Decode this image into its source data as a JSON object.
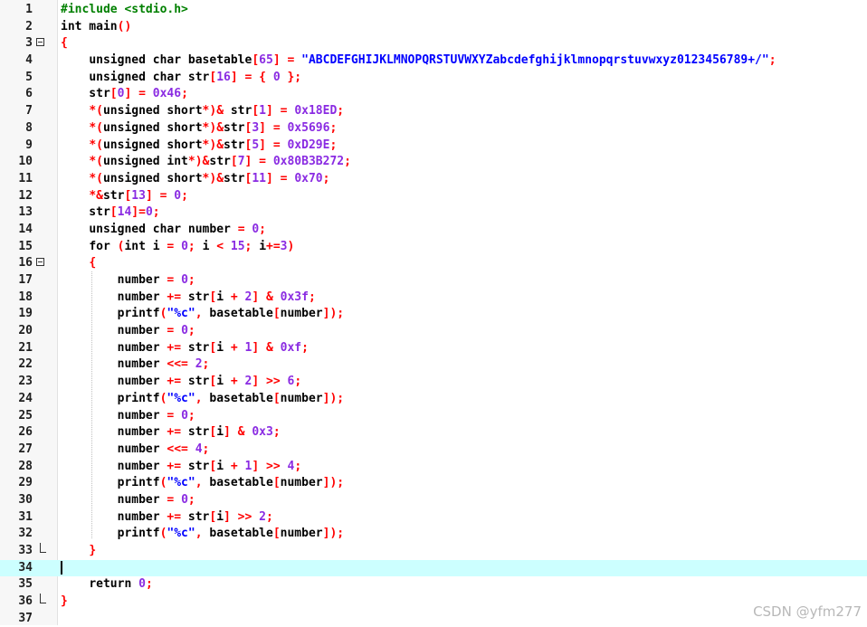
{
  "lines": [
    {
      "n": "1",
      "t": [
        [
          "pp",
          "#include <stdio.h>"
        ]
      ]
    },
    {
      "n": "2",
      "t": [
        [
          "kw",
          "int"
        ],
        [
          "plain",
          " main"
        ],
        [
          "op",
          "()"
        ]
      ]
    },
    {
      "n": "3",
      "fold": "open",
      "t": [
        [
          "op",
          "{"
        ]
      ]
    },
    {
      "n": "4",
      "t": [
        [
          "plain",
          "    "
        ],
        [
          "kw",
          "unsigned char"
        ],
        [
          "plain",
          " basetable"
        ],
        [
          "op",
          "["
        ],
        [
          "num",
          "65"
        ],
        [
          "op",
          "] = "
        ],
        [
          "str",
          "\"ABCDEFGHIJKLMNOPQRSTUVWXYZabcdefghijklmnopqrstuvwxyz0123456789+/\""
        ],
        [
          "op",
          ";"
        ]
      ]
    },
    {
      "n": "5",
      "t": [
        [
          "plain",
          "    "
        ],
        [
          "kw",
          "unsigned char"
        ],
        [
          "plain",
          " str"
        ],
        [
          "op",
          "["
        ],
        [
          "num",
          "16"
        ],
        [
          "op",
          "] = { "
        ],
        [
          "num",
          "0"
        ],
        [
          "op",
          " };"
        ]
      ]
    },
    {
      "n": "6",
      "t": [
        [
          "plain",
          "    str"
        ],
        [
          "op",
          "["
        ],
        [
          "num",
          "0"
        ],
        [
          "op",
          "] = "
        ],
        [
          "num",
          "0x46"
        ],
        [
          "op",
          ";"
        ]
      ]
    },
    {
      "n": "7",
      "t": [
        [
          "plain",
          "    "
        ],
        [
          "op",
          "*("
        ],
        [
          "kw",
          "unsigned short"
        ],
        [
          "op",
          "*)& "
        ],
        [
          "plain",
          "str"
        ],
        [
          "op",
          "["
        ],
        [
          "num",
          "1"
        ],
        [
          "op",
          "] = "
        ],
        [
          "num",
          "0x18ED"
        ],
        [
          "op",
          ";"
        ]
      ]
    },
    {
      "n": "8",
      "t": [
        [
          "plain",
          "    "
        ],
        [
          "op",
          "*("
        ],
        [
          "kw",
          "unsigned short"
        ],
        [
          "op",
          "*)&"
        ],
        [
          "plain",
          "str"
        ],
        [
          "op",
          "["
        ],
        [
          "num",
          "3"
        ],
        [
          "op",
          "] = "
        ],
        [
          "num",
          "0x5696"
        ],
        [
          "op",
          ";"
        ]
      ]
    },
    {
      "n": "9",
      "t": [
        [
          "plain",
          "    "
        ],
        [
          "op",
          "*("
        ],
        [
          "kw",
          "unsigned short"
        ],
        [
          "op",
          "*)&"
        ],
        [
          "plain",
          "str"
        ],
        [
          "op",
          "["
        ],
        [
          "num",
          "5"
        ],
        [
          "op",
          "] = "
        ],
        [
          "num",
          "0xD29E"
        ],
        [
          "op",
          ";"
        ]
      ]
    },
    {
      "n": "10",
      "t": [
        [
          "plain",
          "    "
        ],
        [
          "op",
          "*("
        ],
        [
          "kw",
          "unsigned int"
        ],
        [
          "op",
          "*)&"
        ],
        [
          "plain",
          "str"
        ],
        [
          "op",
          "["
        ],
        [
          "num",
          "7"
        ],
        [
          "op",
          "] = "
        ],
        [
          "num",
          "0x80B3B272"
        ],
        [
          "op",
          ";"
        ]
      ]
    },
    {
      "n": "11",
      "t": [
        [
          "plain",
          "    "
        ],
        [
          "op",
          "*("
        ],
        [
          "kw",
          "unsigned short"
        ],
        [
          "op",
          "*)&"
        ],
        [
          "plain",
          "str"
        ],
        [
          "op",
          "["
        ],
        [
          "num",
          "11"
        ],
        [
          "op",
          "] = "
        ],
        [
          "num",
          "0x70"
        ],
        [
          "op",
          ";"
        ]
      ]
    },
    {
      "n": "12",
      "t": [
        [
          "plain",
          "    "
        ],
        [
          "op",
          "*&"
        ],
        [
          "plain",
          "str"
        ],
        [
          "op",
          "["
        ],
        [
          "num",
          "13"
        ],
        [
          "op",
          "] = "
        ],
        [
          "num",
          "0"
        ],
        [
          "op",
          ";"
        ]
      ]
    },
    {
      "n": "13",
      "t": [
        [
          "plain",
          "    str"
        ],
        [
          "op",
          "["
        ],
        [
          "num",
          "14"
        ],
        [
          "op",
          "]="
        ],
        [
          "num",
          "0"
        ],
        [
          "op",
          ";"
        ]
      ]
    },
    {
      "n": "14",
      "t": [
        [
          "plain",
          "    "
        ],
        [
          "kw",
          "unsigned char"
        ],
        [
          "plain",
          " number "
        ],
        [
          "op",
          "= "
        ],
        [
          "num",
          "0"
        ],
        [
          "op",
          ";"
        ]
      ]
    },
    {
      "n": "15",
      "t": [
        [
          "plain",
          "    "
        ],
        [
          "kw",
          "for"
        ],
        [
          "plain",
          " "
        ],
        [
          "op",
          "("
        ],
        [
          "kw",
          "int"
        ],
        [
          "plain",
          " i "
        ],
        [
          "op",
          "= "
        ],
        [
          "num",
          "0"
        ],
        [
          "op",
          "; "
        ],
        [
          "plain",
          "i "
        ],
        [
          "op",
          "< "
        ],
        [
          "num",
          "15"
        ],
        [
          "op",
          "; "
        ],
        [
          "plain",
          "i"
        ],
        [
          "op",
          "+="
        ],
        [
          "num",
          "3"
        ],
        [
          "op",
          ")"
        ]
      ]
    },
    {
      "n": "16",
      "fold": "open",
      "t": [
        [
          "plain",
          "    "
        ],
        [
          "op",
          "{"
        ]
      ]
    },
    {
      "n": "17",
      "t": [
        [
          "plain",
          "        number "
        ],
        [
          "op",
          "= "
        ],
        [
          "num",
          "0"
        ],
        [
          "op",
          ";"
        ]
      ]
    },
    {
      "n": "18",
      "t": [
        [
          "plain",
          "        number "
        ],
        [
          "op",
          "+= "
        ],
        [
          "plain",
          "str"
        ],
        [
          "op",
          "["
        ],
        [
          "plain",
          "i "
        ],
        [
          "op",
          "+ "
        ],
        [
          "num",
          "2"
        ],
        [
          "op",
          "] & "
        ],
        [
          "num",
          "0x3f"
        ],
        [
          "op",
          ";"
        ]
      ]
    },
    {
      "n": "19",
      "t": [
        [
          "plain",
          "        printf"
        ],
        [
          "op",
          "("
        ],
        [
          "str",
          "\"%c\""
        ],
        [
          "op",
          ", "
        ],
        [
          "plain",
          "basetable"
        ],
        [
          "op",
          "["
        ],
        [
          "plain",
          "number"
        ],
        [
          "op",
          "]);"
        ]
      ]
    },
    {
      "n": "20",
      "t": [
        [
          "plain",
          "        number "
        ],
        [
          "op",
          "= "
        ],
        [
          "num",
          "0"
        ],
        [
          "op",
          ";"
        ]
      ]
    },
    {
      "n": "21",
      "t": [
        [
          "plain",
          "        number "
        ],
        [
          "op",
          "+= "
        ],
        [
          "plain",
          "str"
        ],
        [
          "op",
          "["
        ],
        [
          "plain",
          "i "
        ],
        [
          "op",
          "+ "
        ],
        [
          "num",
          "1"
        ],
        [
          "op",
          "] & "
        ],
        [
          "num",
          "0xf"
        ],
        [
          "op",
          ";"
        ]
      ]
    },
    {
      "n": "22",
      "t": [
        [
          "plain",
          "        number "
        ],
        [
          "op",
          "<<= "
        ],
        [
          "num",
          "2"
        ],
        [
          "op",
          ";"
        ]
      ]
    },
    {
      "n": "23",
      "t": [
        [
          "plain",
          "        number "
        ],
        [
          "op",
          "+= "
        ],
        [
          "plain",
          "str"
        ],
        [
          "op",
          "["
        ],
        [
          "plain",
          "i "
        ],
        [
          "op",
          "+ "
        ],
        [
          "num",
          "2"
        ],
        [
          "op",
          "] >> "
        ],
        [
          "num",
          "6"
        ],
        [
          "op",
          ";"
        ]
      ]
    },
    {
      "n": "24",
      "t": [
        [
          "plain",
          "        printf"
        ],
        [
          "op",
          "("
        ],
        [
          "str",
          "\"%c\""
        ],
        [
          "op",
          ", "
        ],
        [
          "plain",
          "basetable"
        ],
        [
          "op",
          "["
        ],
        [
          "plain",
          "number"
        ],
        [
          "op",
          "]);"
        ]
      ]
    },
    {
      "n": "25",
      "t": [
        [
          "plain",
          "        number "
        ],
        [
          "op",
          "= "
        ],
        [
          "num",
          "0"
        ],
        [
          "op",
          ";"
        ]
      ]
    },
    {
      "n": "26",
      "t": [
        [
          "plain",
          "        number "
        ],
        [
          "op",
          "+= "
        ],
        [
          "plain",
          "str"
        ],
        [
          "op",
          "["
        ],
        [
          "plain",
          "i"
        ],
        [
          "op",
          "] & "
        ],
        [
          "num",
          "0x3"
        ],
        [
          "op",
          ";"
        ]
      ]
    },
    {
      "n": "27",
      "t": [
        [
          "plain",
          "        number "
        ],
        [
          "op",
          "<<= "
        ],
        [
          "num",
          "4"
        ],
        [
          "op",
          ";"
        ]
      ]
    },
    {
      "n": "28",
      "t": [
        [
          "plain",
          "        number "
        ],
        [
          "op",
          "+= "
        ],
        [
          "plain",
          "str"
        ],
        [
          "op",
          "["
        ],
        [
          "plain",
          "i "
        ],
        [
          "op",
          "+ "
        ],
        [
          "num",
          "1"
        ],
        [
          "op",
          "] >> "
        ],
        [
          "num",
          "4"
        ],
        [
          "op",
          ";"
        ]
      ]
    },
    {
      "n": "29",
      "t": [
        [
          "plain",
          "        printf"
        ],
        [
          "op",
          "("
        ],
        [
          "str",
          "\"%c\""
        ],
        [
          "op",
          ", "
        ],
        [
          "plain",
          "basetable"
        ],
        [
          "op",
          "["
        ],
        [
          "plain",
          "number"
        ],
        [
          "op",
          "]);"
        ]
      ]
    },
    {
      "n": "30",
      "t": [
        [
          "plain",
          "        number "
        ],
        [
          "op",
          "= "
        ],
        [
          "num",
          "0"
        ],
        [
          "op",
          ";"
        ]
      ]
    },
    {
      "n": "31",
      "t": [
        [
          "plain",
          "        number "
        ],
        [
          "op",
          "+= "
        ],
        [
          "plain",
          "str"
        ],
        [
          "op",
          "["
        ],
        [
          "plain",
          "i"
        ],
        [
          "op",
          "] >> "
        ],
        [
          "num",
          "2"
        ],
        [
          "op",
          ";"
        ]
      ]
    },
    {
      "n": "32",
      "t": [
        [
          "plain",
          "        printf"
        ],
        [
          "op",
          "("
        ],
        [
          "str",
          "\"%c\""
        ],
        [
          "op",
          ", "
        ],
        [
          "plain",
          "basetable"
        ],
        [
          "op",
          "["
        ],
        [
          "plain",
          "number"
        ],
        [
          "op",
          "]);"
        ]
      ]
    },
    {
      "n": "33",
      "fold": "end",
      "t": [
        [
          "plain",
          "    "
        ],
        [
          "op",
          "}"
        ]
      ]
    },
    {
      "n": "34",
      "current": true,
      "t": []
    },
    {
      "n": "35",
      "t": [
        [
          "plain",
          "    "
        ],
        [
          "kw",
          "return"
        ],
        [
          "plain",
          " "
        ],
        [
          "num",
          "0"
        ],
        [
          "op",
          ";"
        ]
      ]
    },
    {
      "n": "36",
      "fold": "end",
      "t": [
        [
          "op",
          "}"
        ]
      ]
    },
    {
      "n": "37",
      "t": []
    }
  ],
  "watermark": "CSDN @yfm277",
  "colors": {
    "keyword": "#000000",
    "preprocessor": "#008000",
    "number": "#8a2be2",
    "operator": "#ff0000",
    "string": "#0000ff",
    "current_line": "#ccffff"
  }
}
